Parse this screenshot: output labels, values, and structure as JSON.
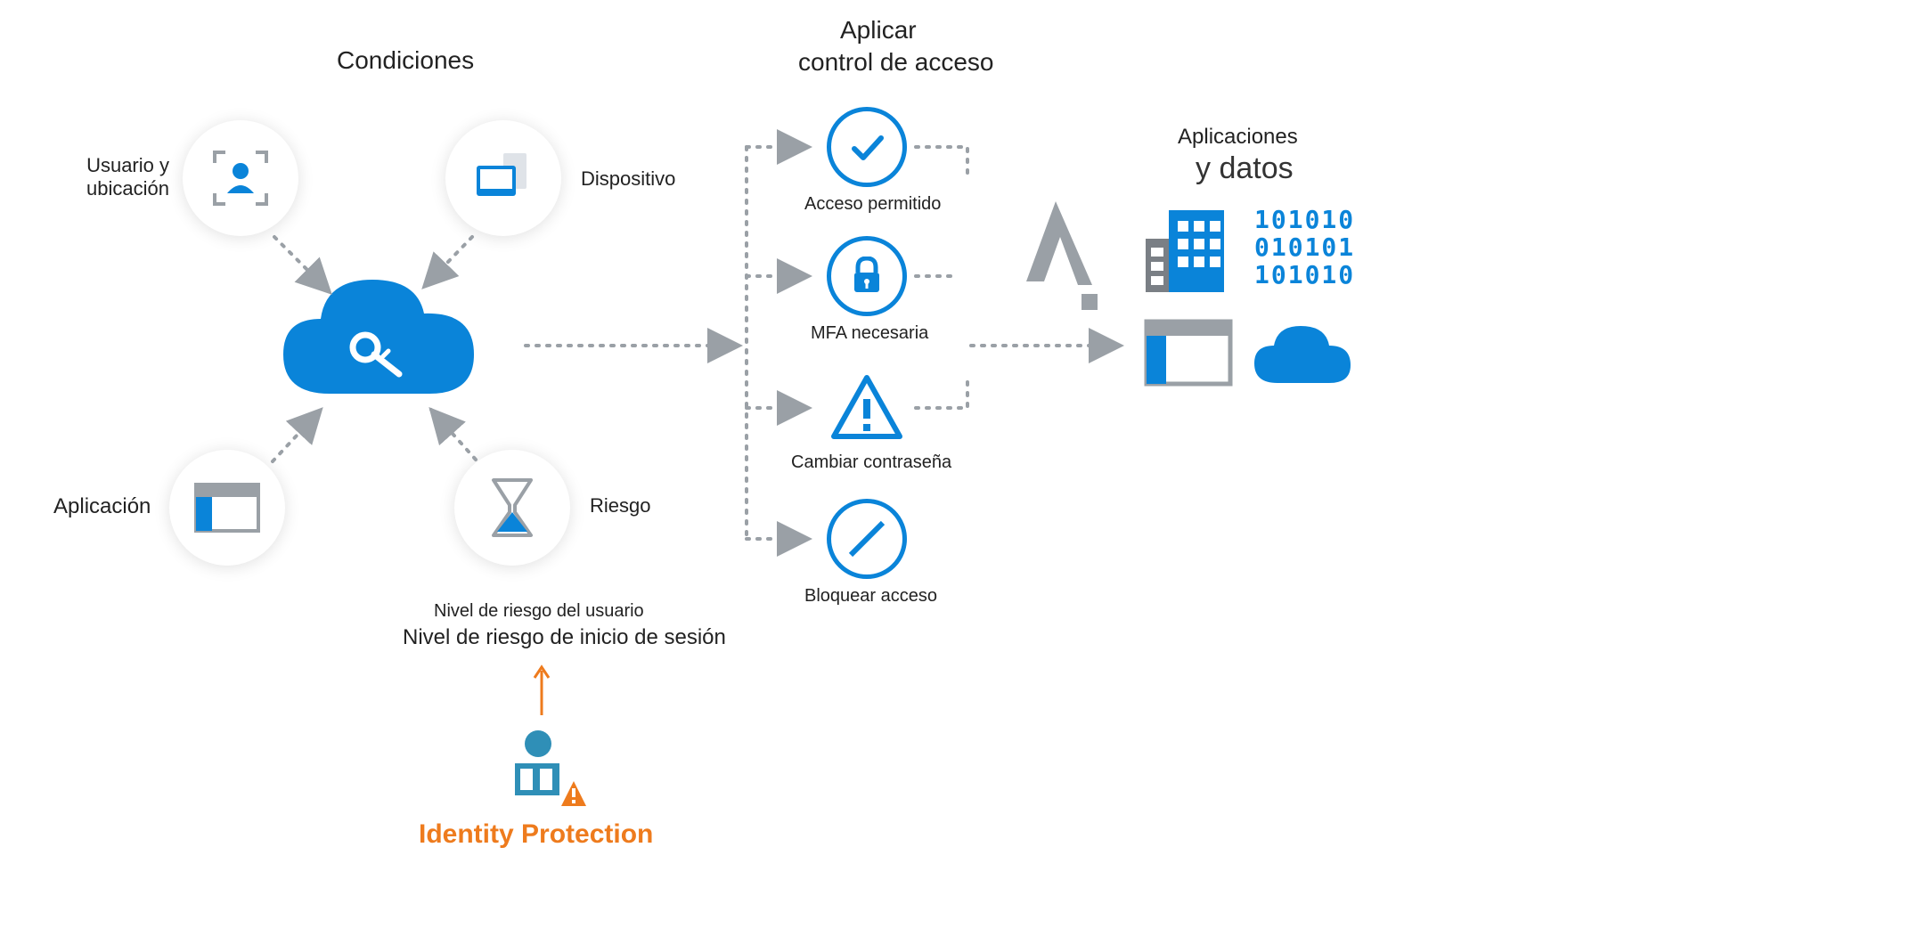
{
  "sections": {
    "conditions_title": "Condiciones",
    "apply_title_line1": "Aplicar",
    "apply_title_line2": "control de acceso",
    "apps_title_line1": "Aplicaciones",
    "apps_title_line2": "y datos"
  },
  "conditions": {
    "user_location": "Usuario y\nubicación",
    "device": "Dispositivo",
    "application": "Aplicación",
    "risk": "Riesgo",
    "user_risk_level": "Nivel de riesgo del usuario",
    "signin_risk_level": "Nivel de riesgo de inicio de sesión"
  },
  "controls": {
    "allow": "Acceso permitido",
    "mfa": "MFA necesaria",
    "change_password": "Cambiar contraseña",
    "block": "Bloquear acceso"
  },
  "identity_protection_label": "Identity Protection",
  "binary_text": "101010\n010101\n101010"
}
